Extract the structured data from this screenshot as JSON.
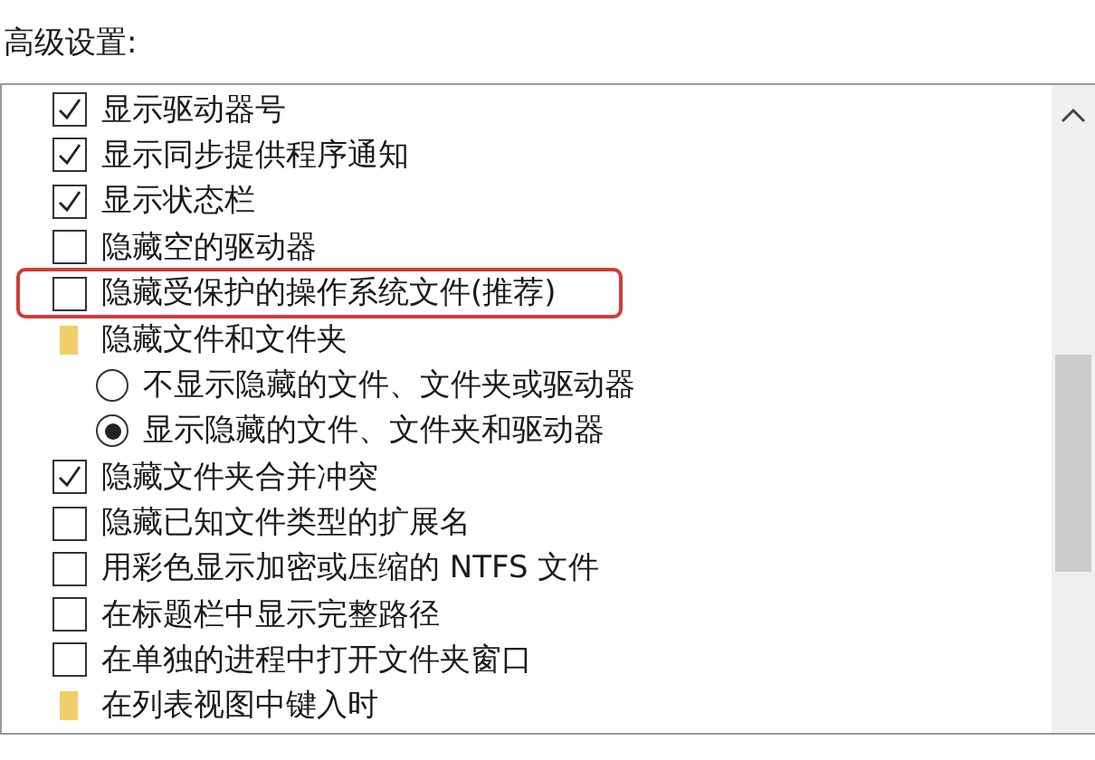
{
  "heading": "高级设置:",
  "items": [
    {
      "kind": "checkbox",
      "label": "显示驱动器号",
      "checked": true,
      "highlighted": false
    },
    {
      "kind": "checkbox",
      "label": "显示同步提供程序通知",
      "checked": true,
      "highlighted": false
    },
    {
      "kind": "checkbox",
      "label": "显示状态栏",
      "checked": true,
      "highlighted": false
    },
    {
      "kind": "checkbox",
      "label": "隐藏空的驱动器",
      "checked": false,
      "highlighted": false
    },
    {
      "kind": "checkbox",
      "label": "隐藏受保护的操作系统文件(推荐)",
      "checked": false,
      "highlighted": true
    },
    {
      "kind": "folder",
      "label": "隐藏文件和文件夹",
      "highlighted": false,
      "children": [
        {
          "kind": "radio",
          "label": "不显示隐藏的文件、文件夹或驱动器",
          "selected": false
        },
        {
          "kind": "radio",
          "label": "显示隐藏的文件、文件夹和驱动器",
          "selected": true
        }
      ]
    },
    {
      "kind": "checkbox",
      "label": "隐藏文件夹合并冲突",
      "checked": true,
      "highlighted": false
    },
    {
      "kind": "checkbox",
      "label": "隐藏已知文件类型的扩展名",
      "checked": false,
      "highlighted": false
    },
    {
      "kind": "checkbox",
      "label": "用彩色显示加密或压缩的 NTFS 文件",
      "checked": false,
      "highlighted": false
    },
    {
      "kind": "checkbox",
      "label": "在标题栏中显示完整路径",
      "checked": false,
      "highlighted": false
    },
    {
      "kind": "checkbox",
      "label": "在单独的进程中打开文件夹窗口",
      "checked": false,
      "highlighted": false
    },
    {
      "kind": "folder",
      "label": "在列表视图中键入时",
      "highlighted": false
    }
  ]
}
